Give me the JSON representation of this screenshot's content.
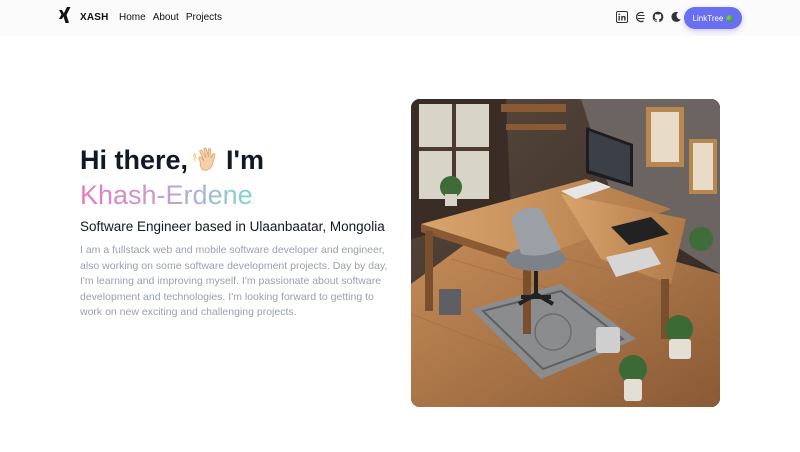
{
  "brand": {
    "name": "XASH",
    "logo_icon": "xing-logo-icon"
  },
  "nav": {
    "links": [
      "Home",
      "About",
      "Projects"
    ]
  },
  "social_icons": [
    "linkedin-icon",
    "hashnode-icon",
    "github-icon",
    "moon-icon"
  ],
  "linktree": {
    "label": "LinkTree",
    "icon": "linktree-icon"
  },
  "hero": {
    "greeting_before": "Hi there,",
    "greeting_emoji": "waving-hand-icon",
    "greeting_after": "I'm",
    "name": "Khash-Erdene",
    "role": "Software Engineer based in Ulaanbaatar, Mongolia",
    "bio": "I am a fullstack web and mobile software developer and engineer, also working on some software development projects. Day by day, I'm learning and improving myself. I'm passionate about software development and technologies. I'm looking forward to getting to work on new exciting and challenging projects."
  },
  "colors": {
    "accent": "#6a6ef0",
    "name_gradient_start": "#e879b8",
    "name_gradient_end": "#7fd7d0",
    "muted_text": "#9aa1ad"
  }
}
